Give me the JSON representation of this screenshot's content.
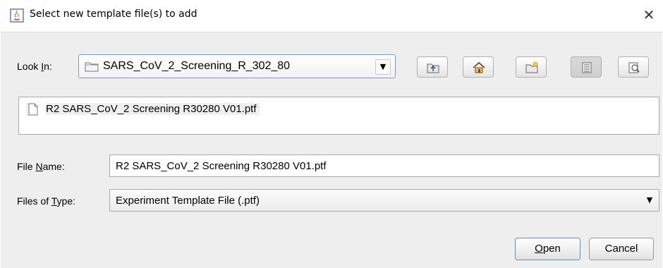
{
  "dialog": {
    "title": "Select new template file(s) to add",
    "close_glyph": "✕",
    "title_icon": "java-app-icon"
  },
  "look_in": {
    "label_pre": "Look ",
    "label_mnemonic": "I",
    "label_post": "n:",
    "value": "SARS_CoV_2_Screening_R_302_80",
    "arrow": "▼"
  },
  "toolbar": {
    "buttons": [
      {
        "name": "up-one-level",
        "icon": "folder-up-icon"
      },
      {
        "name": "home",
        "icon": "home-icon"
      },
      {
        "name": "new-folder",
        "icon": "new-folder-icon"
      },
      {
        "name": "list-view",
        "icon": "list-view-icon",
        "pressed": true
      },
      {
        "name": "details-view",
        "icon": "details-view-icon"
      }
    ]
  },
  "files": [
    {
      "name": "R2 SARS_CoV_2 Screening R30280 V01.ptf",
      "icon": "file-icon",
      "selected": true
    }
  ],
  "file_name": {
    "label_pre": "File ",
    "label_mnemonic": "N",
    "label_post": "ame:",
    "value": "R2 SARS_CoV_2 Screening R30280 V01.ptf"
  },
  "file_type": {
    "label_pre": "Files of ",
    "label_mnemonic": "T",
    "label_post": "ype:",
    "value": "Experiment Template File (.ptf)",
    "arrow": "▼"
  },
  "actions": {
    "open_mnemonic": "O",
    "open_rest": "pen",
    "cancel": "Cancel"
  }
}
